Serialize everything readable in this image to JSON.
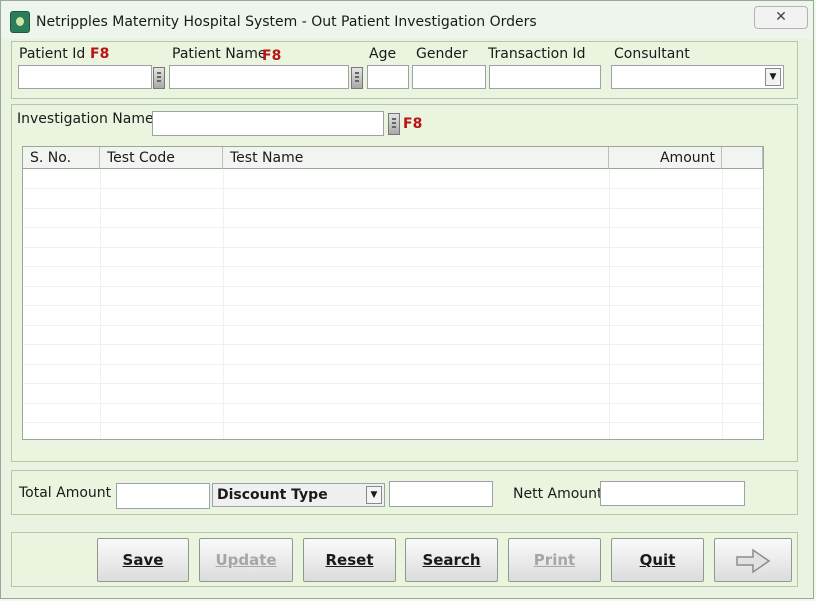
{
  "window": {
    "title": "Netripples Maternity Hospital System - Out Patient Investigation Orders",
    "close_glyph": "✕"
  },
  "patient": {
    "id_label": "Patient Id",
    "id_key": "F8",
    "name_label": "Patient Name",
    "name_key": "F8",
    "age_label": "Age",
    "gender_label": "Gender",
    "transaction_label": "Transaction Id",
    "consultant_label": "Consultant"
  },
  "investigation": {
    "label": "Investigation Name",
    "key": "F8"
  },
  "grid": {
    "columns": [
      "S. No.",
      "Test Code",
      "Test Name",
      "Amount"
    ],
    "rows": []
  },
  "totals": {
    "total_label": "Total Amount",
    "discount_value": "Discount Type",
    "nett_label": "Nett Amount",
    "dropdown_glyph": "▼"
  },
  "buttons": {
    "save": "Save",
    "update": "Update",
    "reset": "Reset",
    "search": "Search",
    "print": "Print",
    "quit": "Quit"
  },
  "icons": {
    "close": "close-icon",
    "next": "right-arrow-icon",
    "lookup": "lookup-scroller-icon",
    "app": "app-logo-icon"
  }
}
